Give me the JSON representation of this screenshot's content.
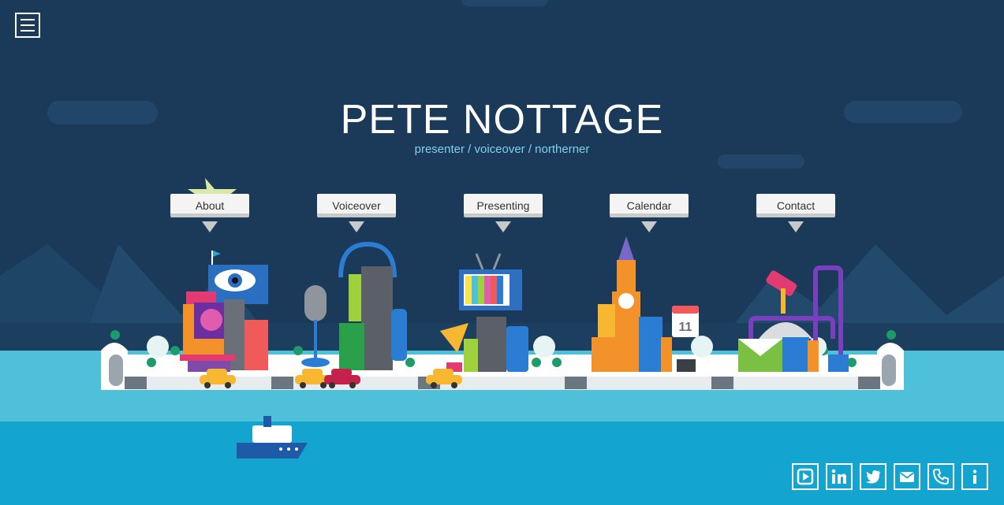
{
  "header": {
    "title": "PETE NOTTAGE",
    "subtitle": "presenter / voiceover / northerner"
  },
  "nav": {
    "items": [
      {
        "label": "About"
      },
      {
        "label": "Voiceover"
      },
      {
        "label": "Presenting"
      },
      {
        "label": "Calendar"
      },
      {
        "label": "Contact"
      }
    ]
  },
  "scene": {
    "calendar_day": "11"
  },
  "social": {
    "icons": [
      "youtube-icon",
      "linkedin-icon",
      "twitter-icon",
      "email-icon",
      "phone-icon",
      "info-icon"
    ]
  },
  "colors": {
    "sky": "#1b3a5a",
    "water_light": "#4fc0da",
    "water_dark": "#13a5d0",
    "subtitle": "#7fd0ea",
    "tag_bg": "#f4f4f4"
  }
}
